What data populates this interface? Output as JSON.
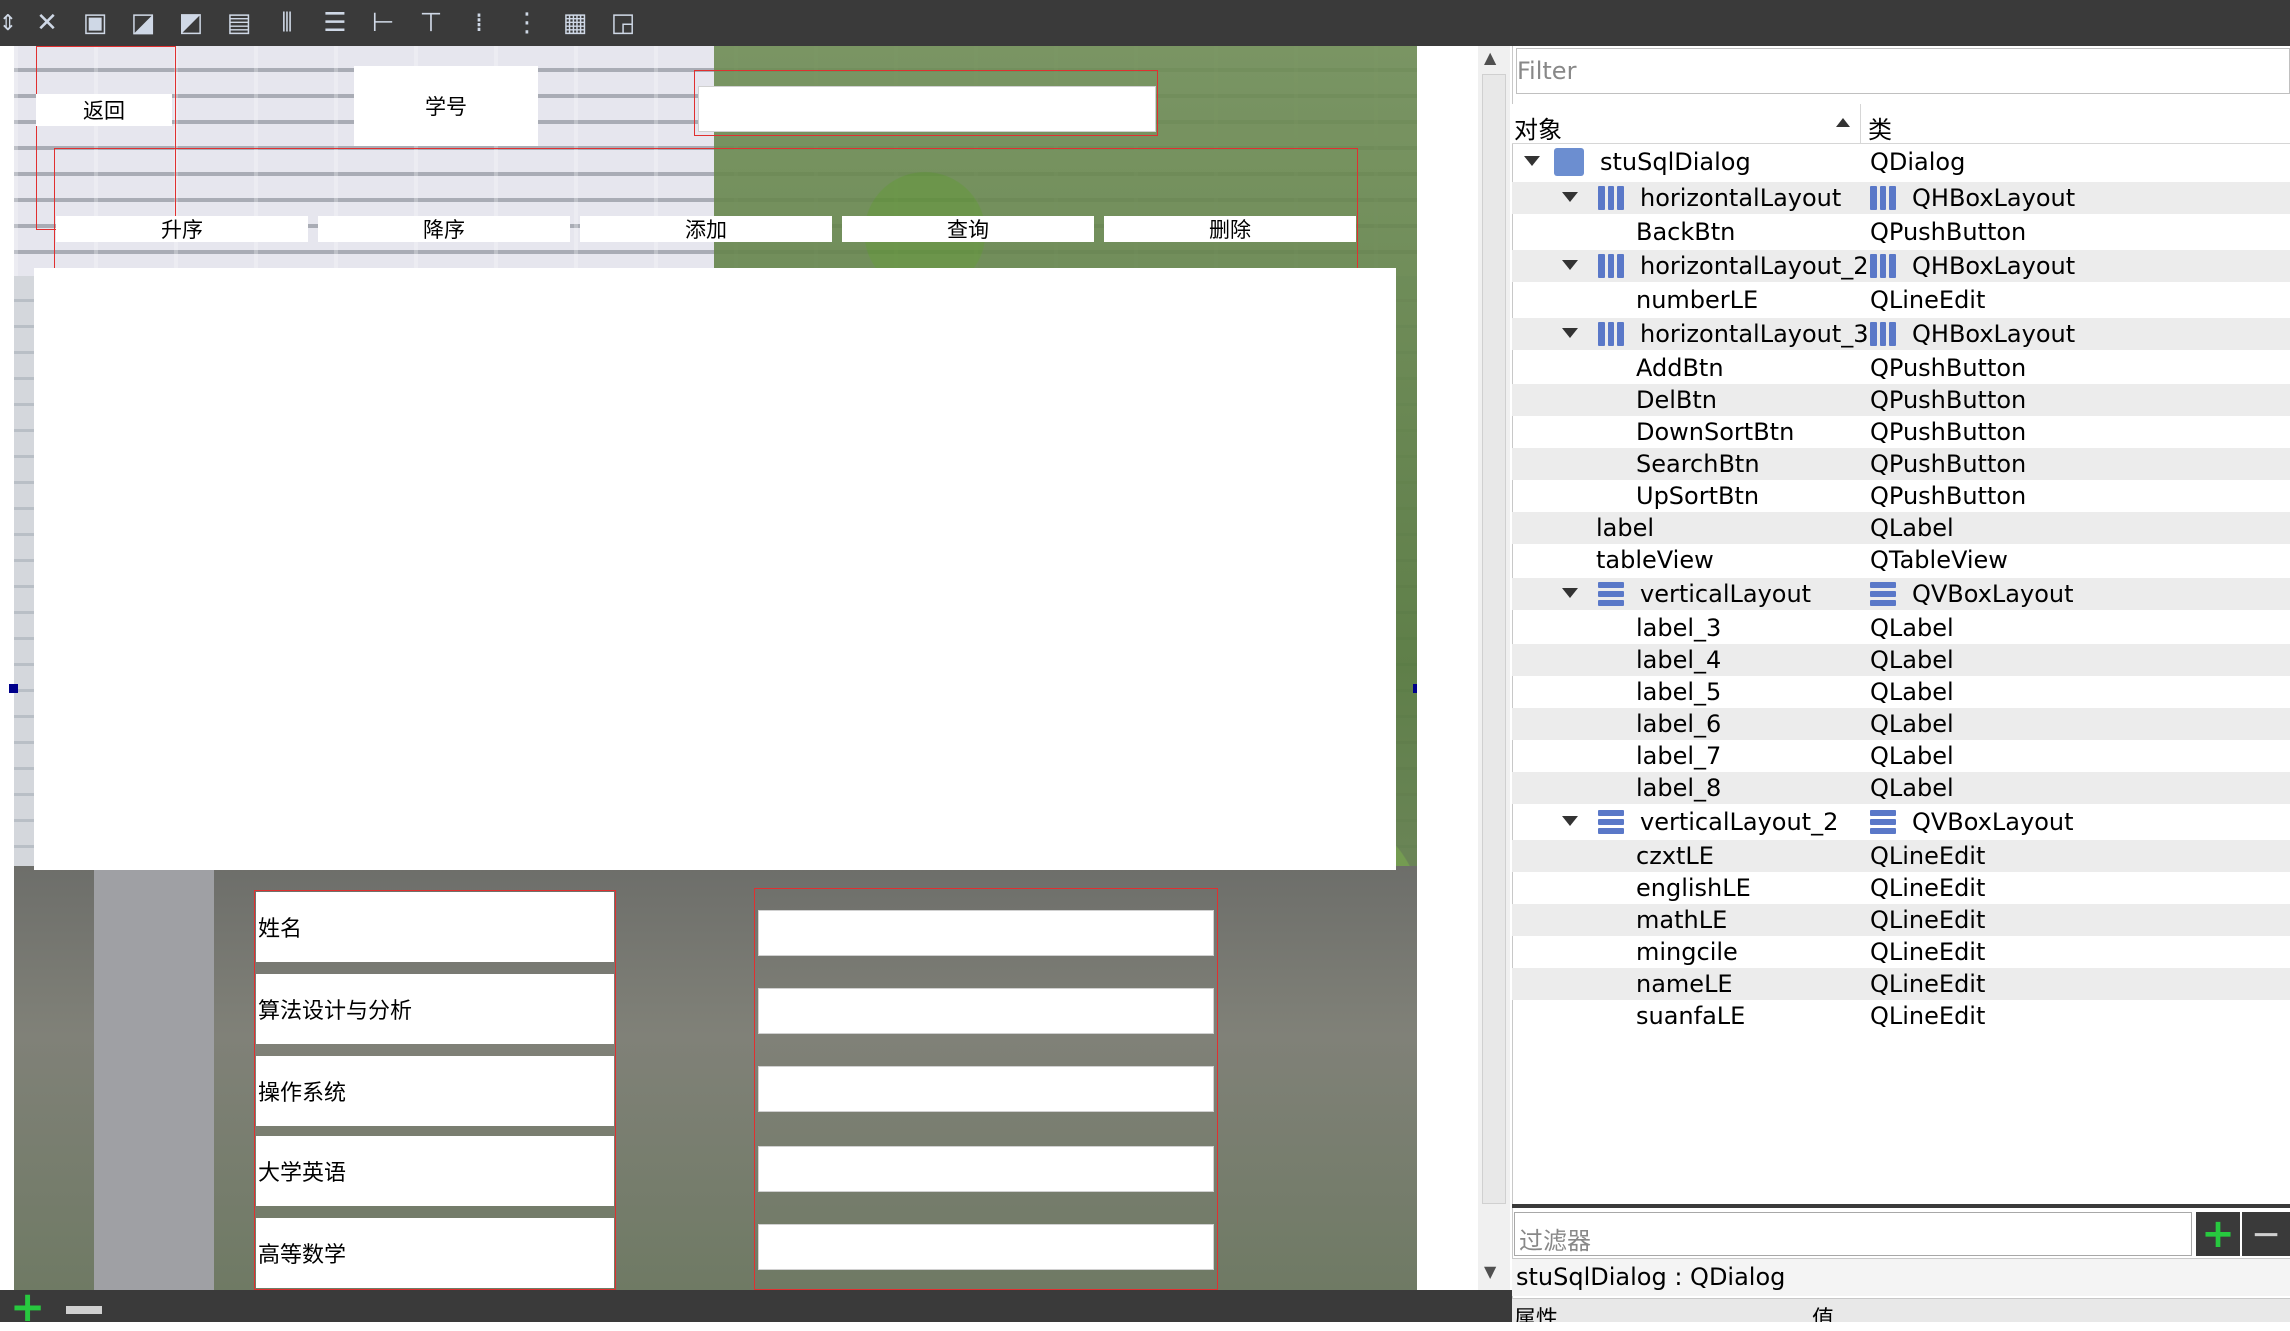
{
  "toolbar": {
    "icons": [
      "resize-arrows-icon",
      "close-icon",
      "edit-widgets-icon",
      "edit-signals-icon",
      "edit-buddies-icon",
      "edit-tab-order-icon",
      "layout-horizontal-icon",
      "layout-vertical-icon",
      "layout-horizontal-splitter-icon",
      "layout-vertical-splitter-icon",
      "layout-form-icon",
      "layout-grid-icon",
      "break-layout-icon",
      "adjust-size-icon"
    ]
  },
  "form": {
    "back_button": "返回",
    "number_label": "学号",
    "number_input": "",
    "buttons": [
      "升序",
      "降序",
      "添加",
      "查询",
      "删除"
    ],
    "fields": [
      {
        "label": "姓名",
        "value": ""
      },
      {
        "label": "算法设计与分析",
        "value": ""
      },
      {
        "label": "操作系统",
        "value": ""
      },
      {
        "label": "大学英语",
        "value": ""
      },
      {
        "label": "高等数学",
        "value": ""
      }
    ]
  },
  "object_inspector": {
    "filter_placeholder": "Filter",
    "col_object": "对象",
    "col_class": "类",
    "rows": [
      {
        "name": "stuSqlDialog",
        "class": "QDialog"
      },
      {
        "name": "horizontalLayout",
        "class": "QHBoxLayout"
      },
      {
        "name": "BackBtn",
        "class": "QPushButton"
      },
      {
        "name": "horizontalLayout_2",
        "class": "QHBoxLayout"
      },
      {
        "name": "numberLE",
        "class": "QLineEdit"
      },
      {
        "name": "horizontalLayout_3",
        "class": "QHBoxLayout"
      },
      {
        "name": "AddBtn",
        "class": "QPushButton"
      },
      {
        "name": "DelBtn",
        "class": "QPushButton"
      },
      {
        "name": "DownSortBtn",
        "class": "QPushButton"
      },
      {
        "name": "SearchBtn",
        "class": "QPushButton"
      },
      {
        "name": "UpSortBtn",
        "class": "QPushButton"
      },
      {
        "name": "label",
        "class": "QLabel"
      },
      {
        "name": "tableView",
        "class": "QTableView"
      },
      {
        "name": "verticalLayout",
        "class": "QVBoxLayout"
      },
      {
        "name": "label_3",
        "class": "QLabel"
      },
      {
        "name": "label_4",
        "class": "QLabel"
      },
      {
        "name": "label_5",
        "class": "QLabel"
      },
      {
        "name": "label_6",
        "class": "QLabel"
      },
      {
        "name": "label_7",
        "class": "QLabel"
      },
      {
        "name": "label_8",
        "class": "QLabel"
      },
      {
        "name": "verticalLayout_2",
        "class": "QVBoxLayout"
      },
      {
        "name": "czxtLE",
        "class": "QLineEdit"
      },
      {
        "name": "englishLE",
        "class": "QLineEdit"
      },
      {
        "name": "mathLE",
        "class": "QLineEdit"
      },
      {
        "name": "mingcile",
        "class": "QLineEdit"
      },
      {
        "name": "nameLE",
        "class": "QLineEdit"
      },
      {
        "name": "suanfaLE",
        "class": "QLineEdit"
      }
    ]
  },
  "property_editor": {
    "filter_placeholder": "过滤器",
    "title": "stuSqlDialog : QDialog",
    "col_property": "属性",
    "col_value": "值"
  },
  "colors": {
    "accent_green": "#27c93f",
    "selection_red": "#e03030",
    "toolbar": "#3a3a3a"
  }
}
